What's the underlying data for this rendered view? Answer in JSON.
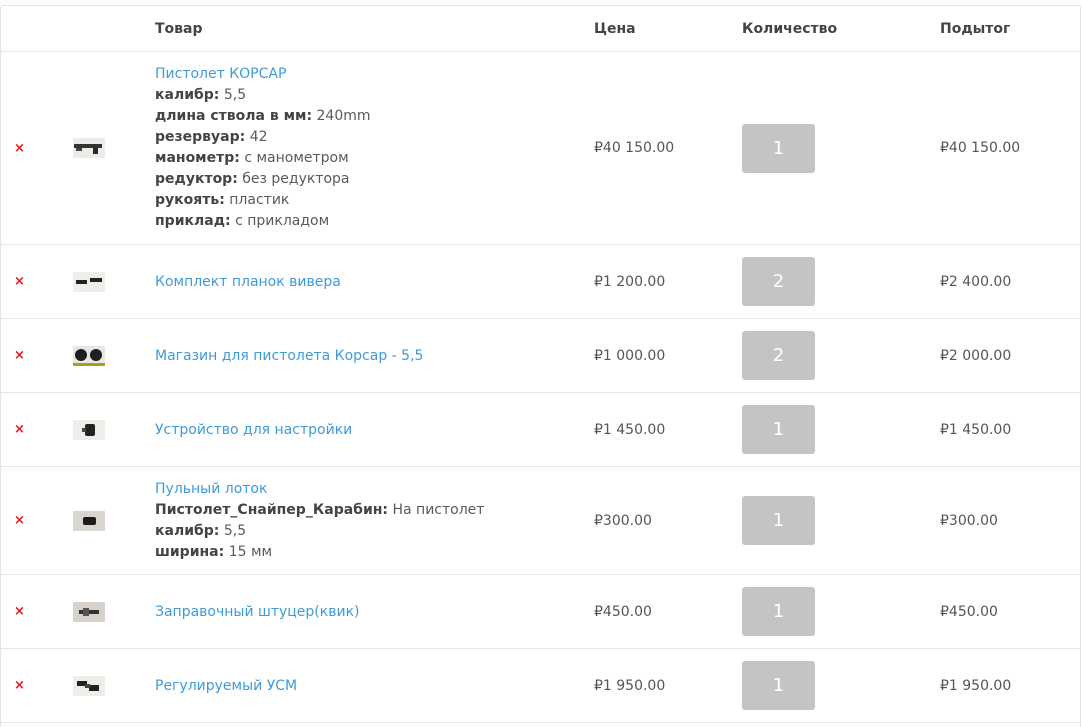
{
  "header": {
    "product": "Товар",
    "price": "Цена",
    "quantity": "Количество",
    "subtotal": "Подытог"
  },
  "colors": {
    "link": "#3f9bd8",
    "remove": "#e2191b",
    "qty_bg": "#c4c4c4",
    "border": "#e6e6e6"
  },
  "items": [
    {
      "remove": "×",
      "thumb_icon": "pistol-thumbnail-icon",
      "name": "Пистолет КОРСАР",
      "attrs": [
        {
          "label": "калибр:",
          "value": "5,5"
        },
        {
          "label": "длина ствола в мм:",
          "value": "240mm"
        },
        {
          "label": "резервуар:",
          "value": "42"
        },
        {
          "label": "манометр:",
          "value": "с манометром"
        },
        {
          "label": "редуктор:",
          "value": "без редуктора"
        },
        {
          "label": "рукоять:",
          "value": "пластик"
        },
        {
          "label": "приклад:",
          "value": "с прикладом"
        }
      ],
      "price": "₽40 150.00",
      "qty": "1",
      "subtotal": "₽40 150.00"
    },
    {
      "remove": "×",
      "thumb_icon": "weaver-rail-thumbnail-icon",
      "name": "Комплект планок вивера",
      "attrs": [],
      "price": "₽1 200.00",
      "qty": "2",
      "subtotal": "₽2 400.00"
    },
    {
      "remove": "×",
      "thumb_icon": "magazine-thumbnail-icon",
      "name": "Магазин для пистолета Корсар - 5,5",
      "attrs": [],
      "price": "₽1 000.00",
      "qty": "2",
      "subtotal": "₽2 000.00"
    },
    {
      "remove": "×",
      "thumb_icon": "tuning-device-thumbnail-icon",
      "name": "Устройство для настройки",
      "attrs": [],
      "price": "₽1 450.00",
      "qty": "1",
      "subtotal": "₽1 450.00"
    },
    {
      "remove": "×",
      "thumb_icon": "pellet-tray-thumbnail-icon",
      "name": "Пульный лоток",
      "attrs": [
        {
          "label": "Пистолет_Снайпер_Карабин:",
          "value": "На пистолет"
        },
        {
          "label": "калибр:",
          "value": "5,5"
        },
        {
          "label": "ширина:",
          "value": "15 мм"
        }
      ],
      "price": "₽300.00",
      "qty": "1",
      "subtotal": "₽300.00"
    },
    {
      "remove": "×",
      "thumb_icon": "fill-nipple-thumbnail-icon",
      "name": "Заправочный штуцер(квик)",
      "attrs": [],
      "price": "₽450.00",
      "qty": "1",
      "subtotal": "₽450.00"
    },
    {
      "remove": "×",
      "thumb_icon": "trigger-thumbnail-icon",
      "name": "Регулируемый УСМ",
      "attrs": [],
      "price": "₽1 950.00",
      "qty": "1",
      "subtotal": "₽1 950.00"
    }
  ]
}
